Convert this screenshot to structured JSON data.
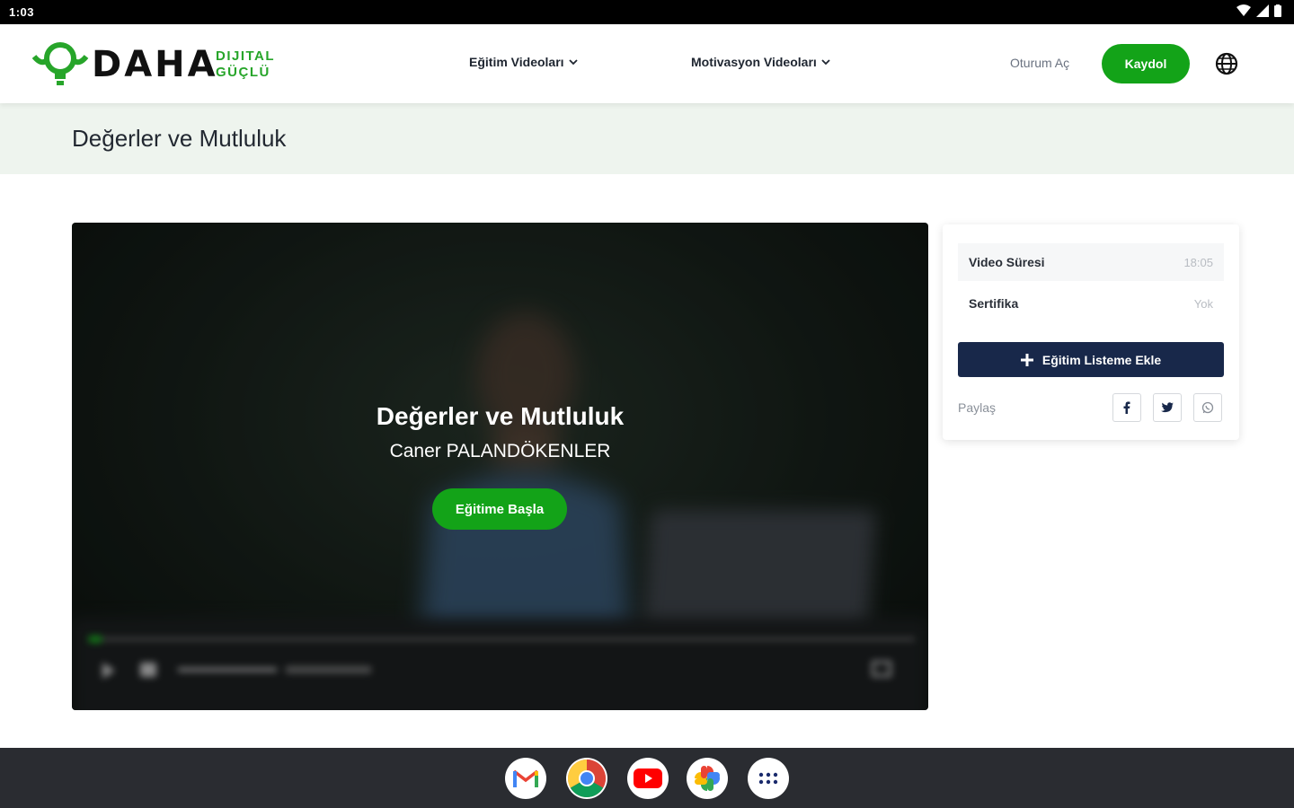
{
  "status_bar": {
    "time": "1:03"
  },
  "header": {
    "logo": {
      "wordmark": "DAHA",
      "sub_line1": "DIJITAL",
      "sub_line2": "GÜÇLÜ"
    },
    "nav": [
      {
        "label": "Eğitim Videoları"
      },
      {
        "label": "Motivasyon Videoları"
      }
    ],
    "login_label": "Oturum Aç",
    "signup_label": "Kaydol"
  },
  "page": {
    "title": "Değerler ve Mutluluk"
  },
  "video": {
    "title": "Değerler ve Mutluluk",
    "author": "Caner PALANDÖKENLER",
    "start_label": "Eğitime Başla"
  },
  "side_card": {
    "rows": [
      {
        "label": "Video Süresi",
        "value": "18:05"
      },
      {
        "label": "Sertifika",
        "value": "Yok"
      }
    ],
    "add_label": "Eğitim Listeme Ekle",
    "share_label": "Paylaş",
    "share_icons": [
      "facebook-icon",
      "twitter-icon",
      "whatsapp-icon"
    ]
  },
  "taskbar": {
    "apps": [
      "gmail",
      "chrome",
      "youtube",
      "photos",
      "app-launcher"
    ]
  },
  "colors": {
    "accent_green": "#13a318",
    "navy": "#18284a",
    "title_band": "#eef4ee"
  }
}
